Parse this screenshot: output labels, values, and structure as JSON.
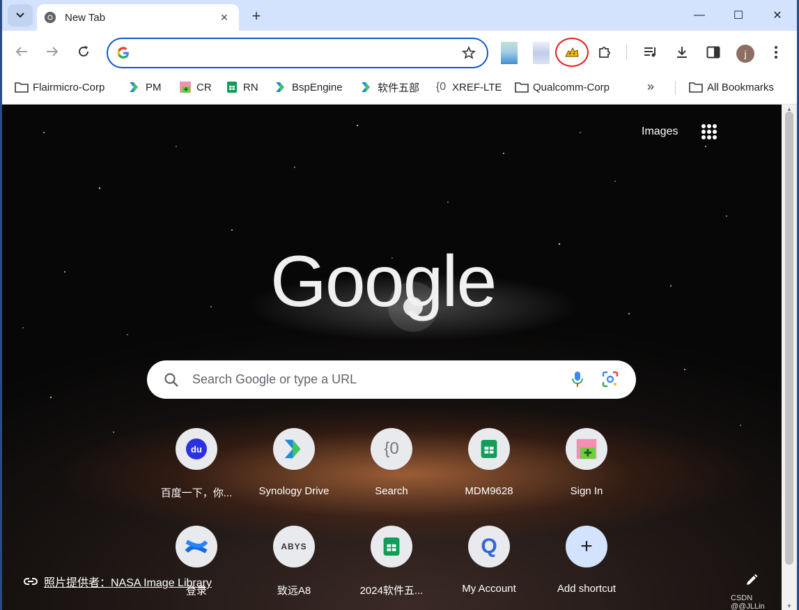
{
  "tab": {
    "title": "New Tab"
  },
  "window_controls": {
    "minimize": "—",
    "maximize": "☐",
    "close": "✕"
  },
  "omnibox": {
    "value": ""
  },
  "bookmarks": [
    {
      "label": "Flairmicro-Corp",
      "icon": "folder-icon"
    },
    {
      "label": "PM",
      "icon": "synology-icon"
    },
    {
      "label": "CR",
      "icon": "redmine-icon"
    },
    {
      "label": "RN",
      "icon": "sheet-icon"
    },
    {
      "label": "BspEngine",
      "icon": "synology-icon"
    },
    {
      "label": "软件五部",
      "icon": "synology-icon"
    },
    {
      "label": "XREF-LTE",
      "icon": "opengrok-icon"
    },
    {
      "label": "Qualcomm-Corp",
      "icon": "folder-icon"
    }
  ],
  "bookmarks_overflow": "»",
  "all_bookmarks": "All Bookmarks",
  "ntp": {
    "images_link": "Images",
    "logo_text": "Google",
    "search_placeholder": "Search Google or type a URL",
    "shortcuts_row1": [
      {
        "label": "百度一下，你...",
        "icon": "baidu-icon",
        "glyph": "du"
      },
      {
        "label": "Synology Drive",
        "icon": "synology-icon",
        "glyph": ""
      },
      {
        "label": "Search",
        "icon": "opengrok-icon",
        "glyph": "{0"
      },
      {
        "label": "MDM9628",
        "icon": "sheet-icon",
        "glyph": ""
      },
      {
        "label": "Sign In",
        "icon": "redmine-icon",
        "glyph": ""
      }
    ],
    "shortcuts_row2": [
      {
        "label": "登录",
        "icon": "confluence-icon",
        "glyph": ""
      },
      {
        "label": "致远A8",
        "icon": "seeyon-icon",
        "glyph": "ABYS"
      },
      {
        "label": "2024软件五...",
        "icon": "sheet-icon",
        "glyph": ""
      },
      {
        "label": "My Account",
        "icon": "q-icon",
        "glyph": "Q"
      },
      {
        "label": "Add shortcut",
        "icon": "plus-icon",
        "glyph": "+"
      }
    ],
    "photo_credit": "照片提供者：NASA Image Library"
  },
  "watermark": "CSDN @@JLLin",
  "avatar_letter": "j",
  "colors": {
    "accent": "#0b57d0",
    "tab_strip": "#d3e3fd",
    "highlight_ring": "#e02020"
  }
}
